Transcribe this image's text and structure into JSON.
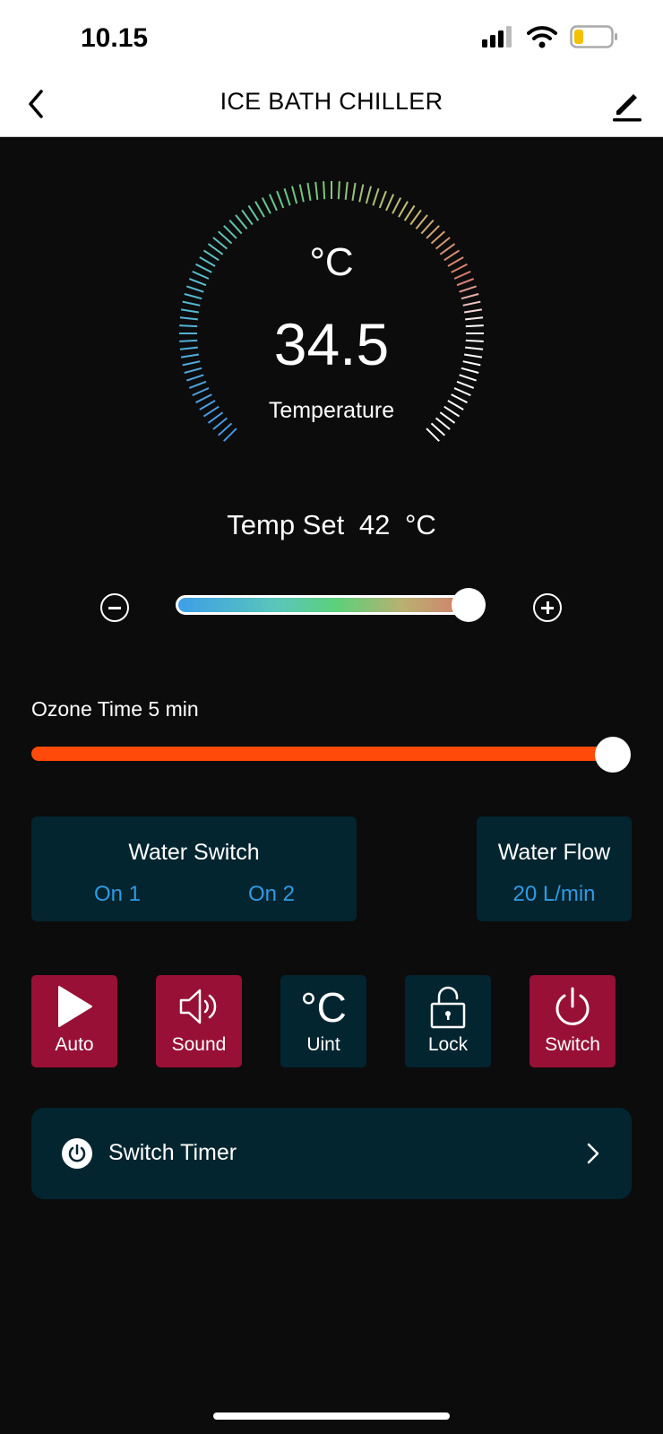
{
  "status": {
    "time": "10.15"
  },
  "nav": {
    "title": "ICE BATH CHILLER"
  },
  "gauge": {
    "unit": "°C",
    "value": "34.5",
    "label": "Temperature"
  },
  "temp_set": {
    "label": "Temp Set",
    "value": "42",
    "unit": "°C",
    "slider_fraction": 0.96
  },
  "ozone": {
    "label": "Ozone Time 5 min",
    "slider_fraction": 1.0
  },
  "water_switch": {
    "title": "Water Switch",
    "option1": "On 1",
    "option2": "On 2"
  },
  "water_flow": {
    "title": "Water Flow",
    "value": "20 L/min"
  },
  "actions": {
    "auto": "Auto",
    "sound": "Sound",
    "unit": "Uint",
    "unit_symbol": "°C",
    "lock": "Lock",
    "switch": "Switch"
  },
  "timer": {
    "label": "Switch Timer"
  },
  "colors": {
    "background": "#0c0c0c",
    "card": "#032530",
    "active": "#981035",
    "link": "#2f9be6",
    "ozone": "#ff4a0a"
  }
}
